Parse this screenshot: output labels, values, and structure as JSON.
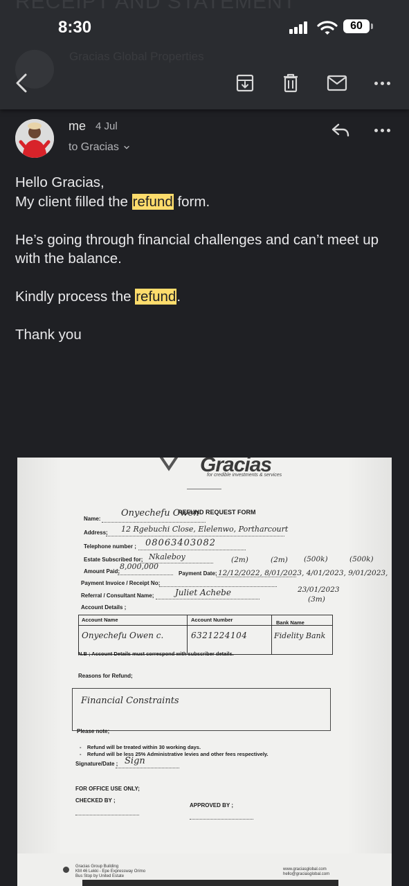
{
  "status_bar": {
    "time": "8:30",
    "battery": "60"
  },
  "header": {
    "subject": "RECEIPT AND STATEMENT",
    "sender_preview": "Gracias Global Properties",
    "back_icon": "chevron-left-icon",
    "actions": [
      {
        "name": "archive",
        "icon": "archive-icon"
      },
      {
        "name": "delete",
        "icon": "trash-icon"
      },
      {
        "name": "mark-unread",
        "icon": "mail-icon"
      },
      {
        "name": "more",
        "icon": "more-horizontal-icon"
      }
    ]
  },
  "message": {
    "sender": "me",
    "date": "4 Jul",
    "recipient_line": "to Gracias",
    "body": {
      "line1": "Hello Gracias,",
      "line2_pre": "My client filled the ",
      "line2_highlight": "refund",
      "line2_post": " form.",
      "para2": "He’s going through financial challenges and can’t meet up with the balance.",
      "line3_pre": "Kindly process the ",
      "line3_highlight": "refund",
      "line3_post": ".",
      "signoff": "Thank you"
    },
    "highlight_color": "#fddc6c"
  },
  "attachment": {
    "logo_text": "Gracias",
    "logo_tagline": "for credible investments & services",
    "form_title": "REFUND REQUEST FORM",
    "labels": {
      "name": "Name:",
      "address": "Address;",
      "telephone": "Telephone number ;",
      "estate": "Estate Subscribed for;",
      "amount": "Amount Paid;",
      "payment_date": "Payment Date;",
      "invoice": "Payment Invoice / Receipt No;",
      "referral": "Referral / Consultant Name;",
      "account_details": "Account Details ;",
      "account_name": "Account Name",
      "account_number": "Account Number",
      "bank_name": "Bank Name",
      "nb": "N.B ; Account Details must correspond with subscriber details.",
      "reasons": "Reasons for Refund;",
      "please_note": "Please note;",
      "note1": "Refund will be treated within 30 working days.",
      "note2": "Refund will be less 25% Administrative levies and other fees respectively.",
      "signature": "Signature/Date ;",
      "office_use": "FOR OFFICE USE ONLY;",
      "checked_by": "CHECKED BY ;",
      "approved_by": "APPROVED BY ;"
    },
    "handwritten": {
      "name": "Onyechefu Owen",
      "address": "12 Rgebuchi Close, Elelenwo, Portharcourt",
      "telephone": "08063403082",
      "estate": "Nkaleboy",
      "amount": "8,000,000",
      "payment_dates": "12/12/2022, 8/01/2023, 4/01/2023, 9/01/2023,",
      "payment_dates_2": "23/01/2023",
      "payment_amounts": [
        "(2m)",
        "(2m)",
        "(500k)",
        "(500k)",
        "(3m)"
      ],
      "referral": "Juliet Achebe",
      "account_name": "Onyechefu Owen c.",
      "account_number": "6321224104",
      "bank_name": "Fidelity Bank",
      "reason": "Financial Constraints",
      "signature": "Sign"
    },
    "footer": {
      "company": "Gracias Group Building",
      "address_1": "KM 46 Lekki - Epe Expressway Orimo",
      "address_2": "Bus Stop by United Estate",
      "website": "www.graciasglobal.com",
      "email": "hello@graciasglobal.com"
    }
  }
}
